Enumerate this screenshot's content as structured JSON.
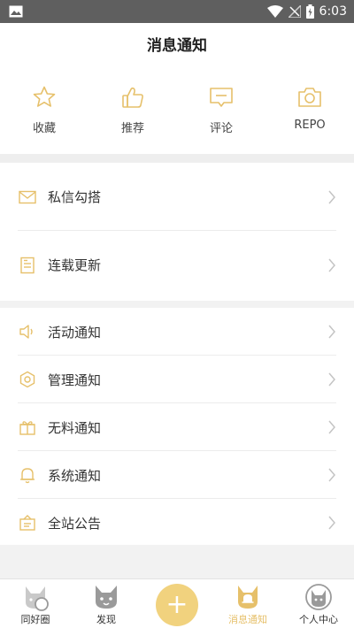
{
  "status_bar": {
    "time": "6:03",
    "icons": [
      "image-icon",
      "wifi-icon",
      "no-signal-icon",
      "battery-icon"
    ]
  },
  "header": {
    "title": "消息通知"
  },
  "quick_actions": [
    {
      "label": "收藏",
      "icon": "star-icon"
    },
    {
      "label": "推荐",
      "icon": "thumbs-up-icon"
    },
    {
      "label": "评论",
      "icon": "comment-icon"
    },
    {
      "label": "REPO",
      "icon": "camera-icon"
    }
  ],
  "group1": [
    {
      "label": "私信勾搭",
      "icon": "mail-icon"
    },
    {
      "label": "连载更新",
      "icon": "document-icon"
    }
  ],
  "group2": [
    {
      "label": "活动通知",
      "icon": "speaker-icon"
    },
    {
      "label": "管理通知",
      "icon": "hexagon-icon"
    },
    {
      "label": "无料通知",
      "icon": "gift-icon"
    },
    {
      "label": "系统通知",
      "icon": "bell-icon"
    },
    {
      "label": "全站公告",
      "icon": "notice-board-icon"
    }
  ],
  "tab_bar": [
    {
      "label": "同好圈",
      "icon": "cat-circle-icon"
    },
    {
      "label": "发现",
      "icon": "cat-discover-icon"
    },
    {
      "label": "+",
      "icon": "plus-icon"
    },
    {
      "label": "消息通知",
      "icon": "cat-bell-icon",
      "active": true
    },
    {
      "label": "个人中心",
      "icon": "cat-profile-icon"
    }
  ],
  "colors": {
    "accent": "#e6c06a",
    "fab": "#f1d27e",
    "status_bar": "#5f5f5f"
  }
}
